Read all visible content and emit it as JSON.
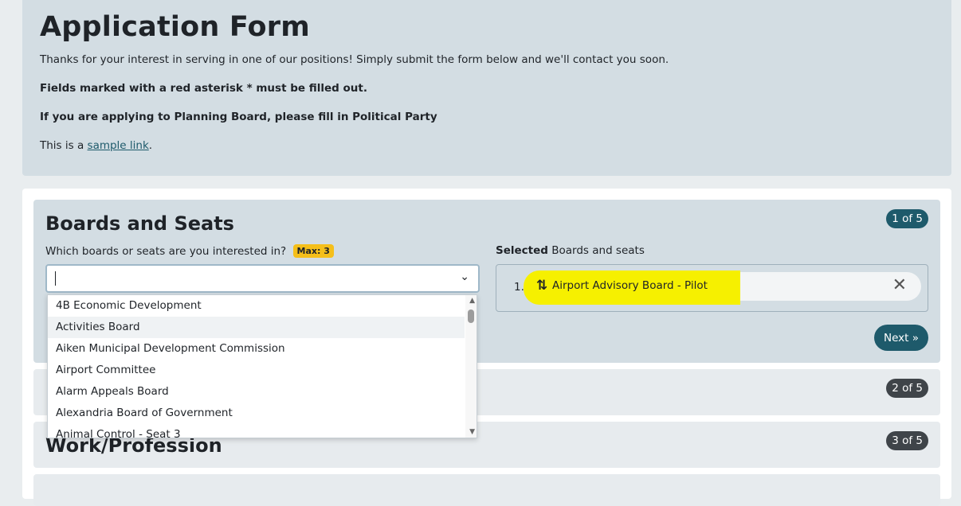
{
  "header": {
    "title": "Application Form",
    "intro": "Thanks for your interest in serving in one of our positions! Simply submit the form below and we'll contact you soon.",
    "required_note": "Fields marked with a red asterisk * must be filled out.",
    "planning_note": "If you are applying to Planning Board, please fill in Political Party",
    "sample_prefix": "This is a ",
    "sample_link": "sample link",
    "sample_suffix": "."
  },
  "sections": [
    {
      "title": "Boards and Seats",
      "step": "1 of 5"
    },
    {
      "title": "",
      "step": "2 of 5"
    },
    {
      "title": "Work/Profession",
      "step": "3 of 5"
    }
  ],
  "boards": {
    "question": "Which boards or seats are you interested in?",
    "max_badge": "Max: 3",
    "selected_label_bold": "Selected",
    "selected_label_rest": " Boards and seats",
    "selected_items": [
      {
        "index": "1.",
        "label": "Airport Advisory Board - Pilot"
      }
    ],
    "next_label": "Next »",
    "options": [
      "4B Economic Development",
      "Activities Board",
      "Aiken Municipal Development Commission",
      "Airport Committee",
      "Alarm Appeals Board",
      "Alexandria Board of Government",
      "Animal Control - Seat 3"
    ]
  },
  "colors": {
    "accent": "#1e5a6b",
    "badge_dark": "#3f4449",
    "max_badge": "#f5bf1a",
    "highlight": "#f6f000"
  }
}
